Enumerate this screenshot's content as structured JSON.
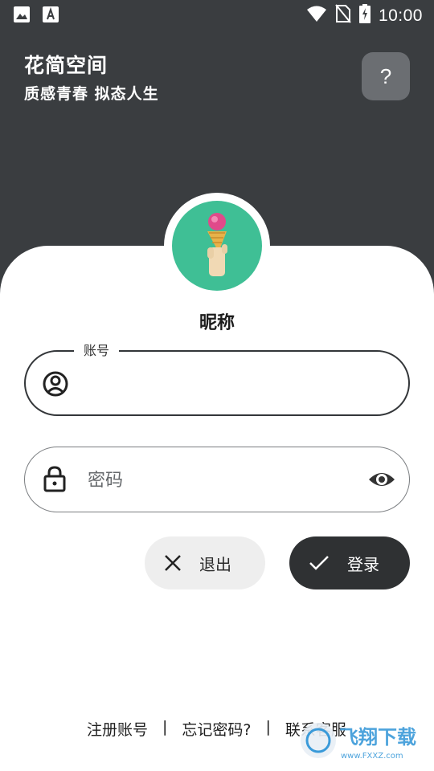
{
  "status_bar": {
    "time": "10:00",
    "icons": [
      "image-icon",
      "font-download-icon",
      "wifi-icon",
      "no-sim-icon",
      "battery-charging-icon"
    ]
  },
  "header": {
    "title": "花简空间",
    "subtitle": "质感青春 拟态人生",
    "help_label": "?"
  },
  "profile": {
    "nickname": "昵称"
  },
  "account_field": {
    "legend": "账号",
    "value": "",
    "icon": "account-circle-icon"
  },
  "password_field": {
    "placeholder": "密码",
    "value": "",
    "icon": "lock-icon",
    "toggle_icon": "eye-icon"
  },
  "buttons": {
    "exit_label": "退出",
    "login_label": "登录"
  },
  "footer": {
    "register": "注册账号",
    "separator": "|",
    "forgot": "忘记密码?",
    "contact": "联系客服"
  },
  "watermark": {
    "text": "飞翔下载",
    "url": "www.FXXZ.com"
  },
  "colors": {
    "header_bg": "#3a3d40",
    "avatar_bg": "#3fbf95",
    "login_bg": "#2f3133",
    "exit_bg": "#eeeeee"
  }
}
